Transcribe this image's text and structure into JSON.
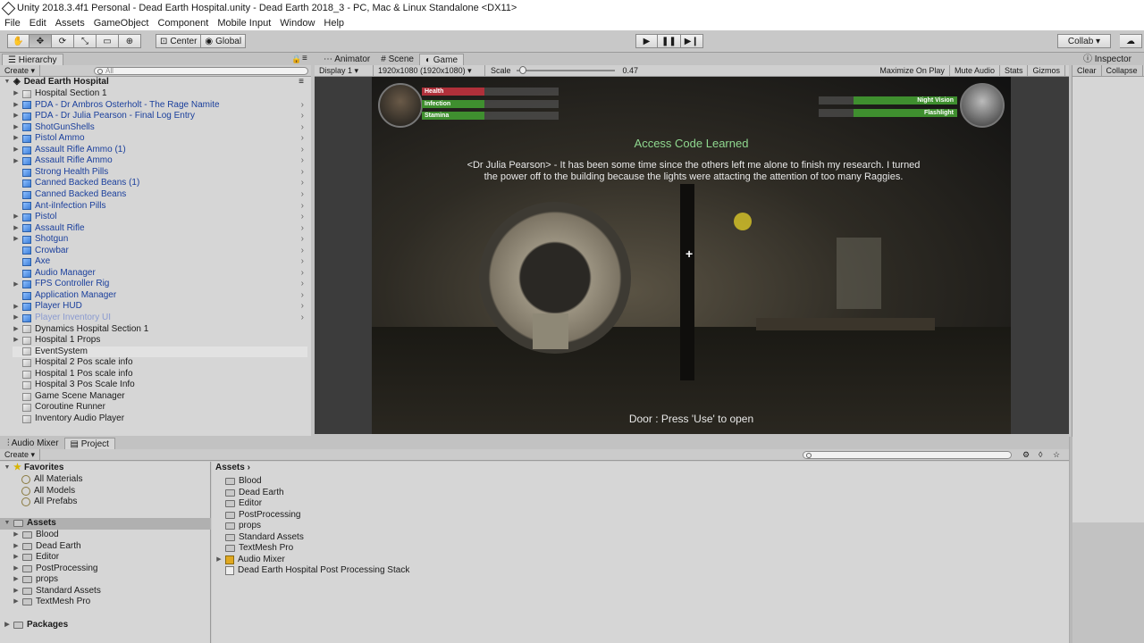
{
  "window": {
    "title": "Unity 2018.3.4f1 Personal - Dead Earth Hospital.unity - Dead Earth 2018_3 - PC, Mac & Linux Standalone <DX11>"
  },
  "menu": [
    "File",
    "Edit",
    "Assets",
    "GameObject",
    "Component",
    "Mobile Input",
    "Window",
    "Help"
  ],
  "toolbar": {
    "pivot": "Center",
    "space": "Global",
    "collab": "Collab ▾",
    "tools": [
      "hand-icon",
      "move-icon",
      "rotate-icon",
      "scale-icon",
      "rect-icon",
      "transform-icon"
    ]
  },
  "hierarchy": {
    "tab": "Hierarchy",
    "create": "Create",
    "search_placeholder": "All",
    "scene": "Dead Earth Hospital",
    "items": [
      {
        "label": "Hospital Section 1",
        "type": "gray",
        "arrow": true
      },
      {
        "label": "PDA - Dr Ambros Osterholt - The Rage Namite",
        "type": "prefab",
        "arrow": true
      },
      {
        "label": "PDA - Dr Julia Pearson - Final Log Entry",
        "type": "prefab",
        "arrow": true
      },
      {
        "label": "ShotGunShells",
        "type": "prefab",
        "arrow": true
      },
      {
        "label": "Pistol Ammo",
        "type": "prefab",
        "arrow": true
      },
      {
        "label": "Assault Rifle Ammo (1)",
        "type": "prefab",
        "arrow": true
      },
      {
        "label": "Assault Rifle Ammo",
        "type": "prefab",
        "arrow": true
      },
      {
        "label": "Strong Health Pills",
        "type": "prefab",
        "arrow": false
      },
      {
        "label": "Canned Backed Beans (1)",
        "type": "prefab",
        "arrow": false
      },
      {
        "label": "Canned Backed Beans",
        "type": "prefab",
        "arrow": false
      },
      {
        "label": "Ant-iInfection Pills",
        "type": "prefab",
        "arrow": false
      },
      {
        "label": "Pistol",
        "type": "prefab",
        "arrow": true
      },
      {
        "label": "Assault Rifle",
        "type": "prefab",
        "arrow": true
      },
      {
        "label": "Shotgun",
        "type": "prefab",
        "arrow": true
      },
      {
        "label": "Crowbar",
        "type": "prefab",
        "arrow": false
      },
      {
        "label": "Axe",
        "type": "prefab",
        "arrow": false
      },
      {
        "label": "Audio Manager",
        "type": "prefab",
        "arrow": false
      },
      {
        "label": "FPS Controller Rig",
        "type": "prefab",
        "arrow": true
      },
      {
        "label": "Application Manager",
        "type": "prefab",
        "arrow": false
      },
      {
        "label": "Player HUD",
        "type": "prefab",
        "arrow": true
      },
      {
        "label": "Player Inventory UI",
        "type": "prefab-dim",
        "arrow": true
      },
      {
        "label": "Dynamics Hospital Section 1",
        "type": "gray",
        "arrow": true
      },
      {
        "label": "Hospital 1 Props",
        "type": "gray",
        "arrow": true
      },
      {
        "label": "EventSystem",
        "type": "gray",
        "arrow": false
      },
      {
        "label": "Hospital 2 Pos scale info",
        "type": "gray",
        "arrow": false
      },
      {
        "label": "Hospital 1 Pos scale info",
        "type": "gray",
        "arrow": false
      },
      {
        "label": "Hospital 3 Pos Scale Info",
        "type": "gray",
        "arrow": false
      },
      {
        "label": "Game Scene Manager",
        "type": "gray",
        "arrow": false
      },
      {
        "label": "Coroutine Runner",
        "type": "gray",
        "arrow": false
      },
      {
        "label": "Inventory Audio Player",
        "type": "gray",
        "arrow": false
      }
    ]
  },
  "center_tabs": [
    "Animator",
    "Scene",
    "Game"
  ],
  "game_bar": {
    "display": "Display 1",
    "resolution": "1920x1080 (1920x1080)",
    "scale_label": "Scale",
    "scale_value": "0.47",
    "scale_fraction": 0.03,
    "options": [
      "Maximize On Play",
      "Mute Audio",
      "Stats",
      "Gizmos"
    ]
  },
  "game": {
    "bars_left": [
      {
        "label": "Health",
        "color": "#b0303a",
        "fill": 0.46
      },
      {
        "label": "Infection",
        "color": "#3f8f2f",
        "fill": 0.46
      },
      {
        "label": "Stamina",
        "color": "#3f8f2f",
        "fill": 0.46
      }
    ],
    "bars_right": [
      {
        "label": "Night Vision",
        "color": "#3f8f2f",
        "fill": 0.75
      },
      {
        "label": "Flashlight",
        "color": "#3f8f2f",
        "fill": 0.75
      }
    ],
    "access_code": "Access Code Learned",
    "log_text": "<Dr Julia Pearson> - It has been some time since the others left me alone to finish my research. I turned the power off to the building because the lights were attacting the attention of too many Raggies.",
    "interact": "Door : Press 'Use' to open",
    "crosshair": "+"
  },
  "inspector": {
    "tab": "Inspector",
    "clear": "Clear",
    "collapse": "Collapse"
  },
  "bottom_tabs": [
    "Audio Mixer",
    "Project"
  ],
  "project": {
    "create": "Create",
    "favorites_label": "Favorites",
    "favorites": [
      "All Materials",
      "All Models",
      "All Prefabs"
    ],
    "assets_label": "Assets",
    "asset_tree": [
      "Blood",
      "Dead Earth",
      "Editor",
      "PostProcessing",
      "props",
      "Standard Assets",
      "TextMesh Pro"
    ],
    "packages_label": "Packages",
    "breadcrumb": "Assets",
    "contents": [
      {
        "label": "Blood",
        "kind": "folder"
      },
      {
        "label": "Dead Earth",
        "kind": "folder"
      },
      {
        "label": "Editor",
        "kind": "folder"
      },
      {
        "label": "PostProcessing",
        "kind": "folder"
      },
      {
        "label": "props",
        "kind": "folder"
      },
      {
        "label": "Standard Assets",
        "kind": "folder"
      },
      {
        "label": "TextMesh Pro",
        "kind": "folder"
      },
      {
        "label": "Audio Mixer",
        "kind": "mixer"
      },
      {
        "label": "Dead Earth Hospital Post Processing Stack",
        "kind": "asset"
      }
    ]
  }
}
